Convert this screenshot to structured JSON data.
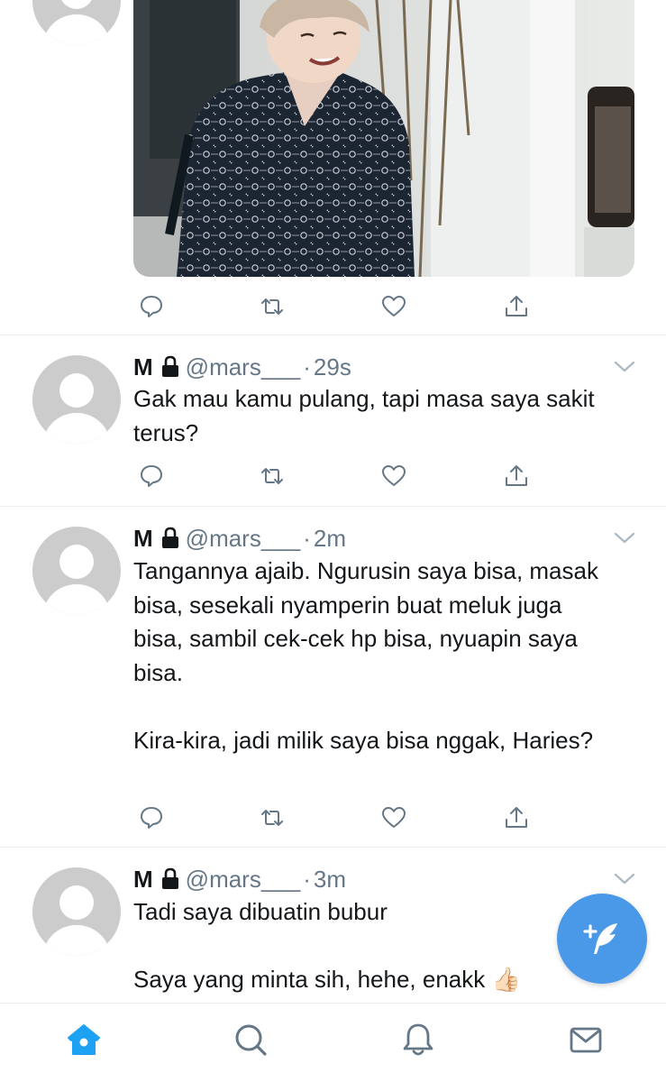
{
  "tweets": [
    {
      "name": "M",
      "handle": "@mars___",
      "separator": "·",
      "time": "29s",
      "text": "Gak mau kamu pulang, tapi masa saya sakit terus?"
    },
    {
      "name": "M",
      "handle": "@mars___",
      "separator": "·",
      "time": "2m",
      "text": "Tangannya ajaib. Ngurusin saya bisa, masak bisa, sesekali nyamperin buat meluk juga bisa, sambil cek-cek hp bisa, nyuapin saya bisa.\n\nKira-kira, jadi milik saya bisa nggak, Haries?"
    },
    {
      "name": "M",
      "handle": "@mars___",
      "separator": "·",
      "time": "3m",
      "text": "Tadi saya dibuatin bubur\n\nSaya yang minta sih, hehe, enakk 👍🏻"
    }
  ],
  "icons": {
    "reply": "reply-icon",
    "retweet": "retweet-icon",
    "like": "heart-icon",
    "share": "share-icon",
    "lock": "lock-icon",
    "compose": "compose-tweet-icon",
    "home": "home-icon",
    "search": "search-icon",
    "notifications": "bell-icon",
    "messages": "mail-icon"
  },
  "colors": {
    "accent": "#1da1f2",
    "fab": "#4a99e9",
    "secondary_text": "#657786",
    "icon_gray": "#657786",
    "divider": "#e6ecf0"
  }
}
